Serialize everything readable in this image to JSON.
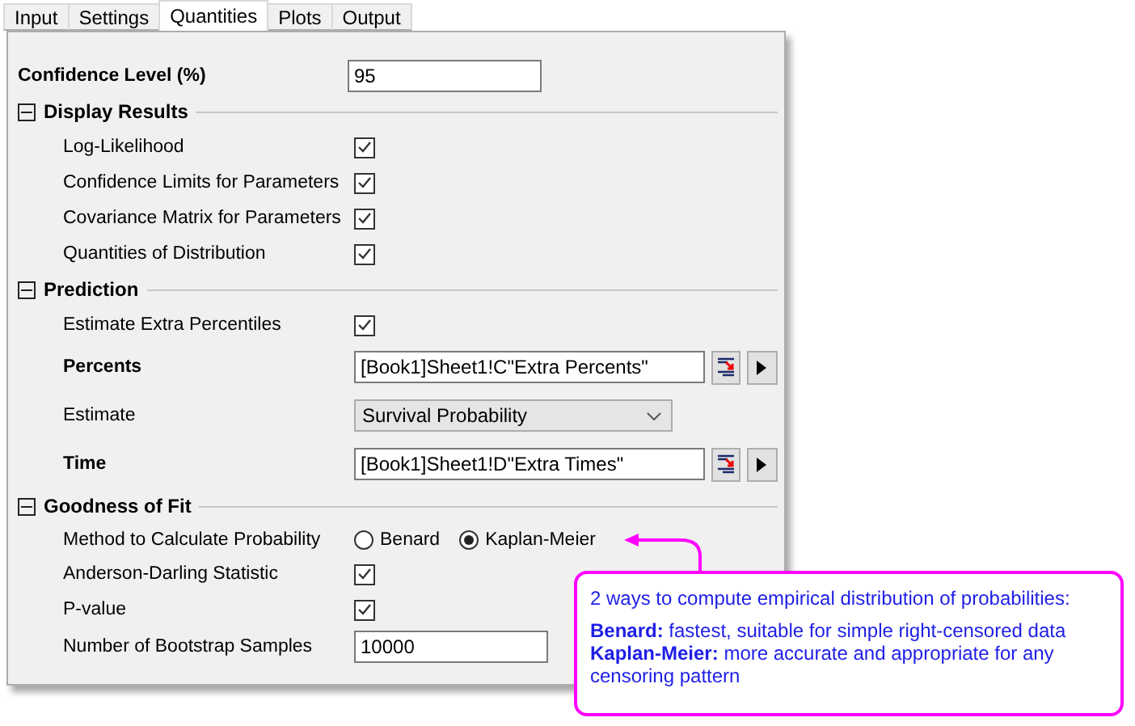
{
  "tabs": [
    {
      "label": "Input",
      "selected": false
    },
    {
      "label": "Settings",
      "selected": false
    },
    {
      "label": "Quantities",
      "selected": true
    },
    {
      "label": "Plots",
      "selected": false
    },
    {
      "label": "Output",
      "selected": false
    }
  ],
  "confidence_level": {
    "label": "Confidence Level (%)",
    "value": "95"
  },
  "sections": [
    {
      "title": "Display Results",
      "expanded": true,
      "rows": [
        {
          "kind": "checkbox",
          "label": "Log-Likelihood",
          "bold": false,
          "checked": true
        },
        {
          "kind": "checkbox",
          "label": "Confidence Limits for Parameters",
          "bold": false,
          "checked": true
        },
        {
          "kind": "checkbox",
          "label": "Covariance Matrix for Parameters",
          "bold": false,
          "checked": true
        },
        {
          "kind": "checkbox",
          "label": "Quantities of Distribution",
          "bold": false,
          "checked": true
        }
      ]
    },
    {
      "title": "Prediction",
      "expanded": true,
      "rows": [
        {
          "kind": "checkbox",
          "label": "Estimate Extra Percentiles",
          "bold": false,
          "checked": true
        },
        {
          "kind": "range",
          "label": "Percents",
          "bold": true,
          "value": "[Book1]Sheet1!C\"Extra Percents\""
        },
        {
          "kind": "dropdown",
          "label": "Estimate",
          "bold": false,
          "value": "Survival Probability"
        },
        {
          "kind": "range",
          "label": "Time",
          "bold": true,
          "value": "[Book1]Sheet1!D\"Extra Times\""
        }
      ]
    },
    {
      "title": "Goodness of Fit",
      "expanded": true,
      "rows": [
        {
          "kind": "radio",
          "label": "Method to Calculate Probability",
          "bold": false,
          "options": [
            {
              "label": "Benard",
              "selected": false
            },
            {
              "label": "Kaplan-Meier",
              "selected": true
            }
          ]
        },
        {
          "kind": "checkbox",
          "label": "Anderson-Darling Statistic",
          "bold": false,
          "checked": true
        },
        {
          "kind": "checkbox",
          "label": "P-value",
          "bold": false,
          "checked": true
        },
        {
          "kind": "text",
          "label": "Number of Bootstrap Samples",
          "bold": false,
          "value": "10000"
        }
      ]
    }
  ],
  "callout": {
    "lines": [
      "2 ways to compute empirical distribution of probabilities:",
      "**Benard:** fastest, suitable for simple right-censored data",
      "**Kaplan-Meier:** more accurate and appropriate for any censoring pattern"
    ]
  }
}
